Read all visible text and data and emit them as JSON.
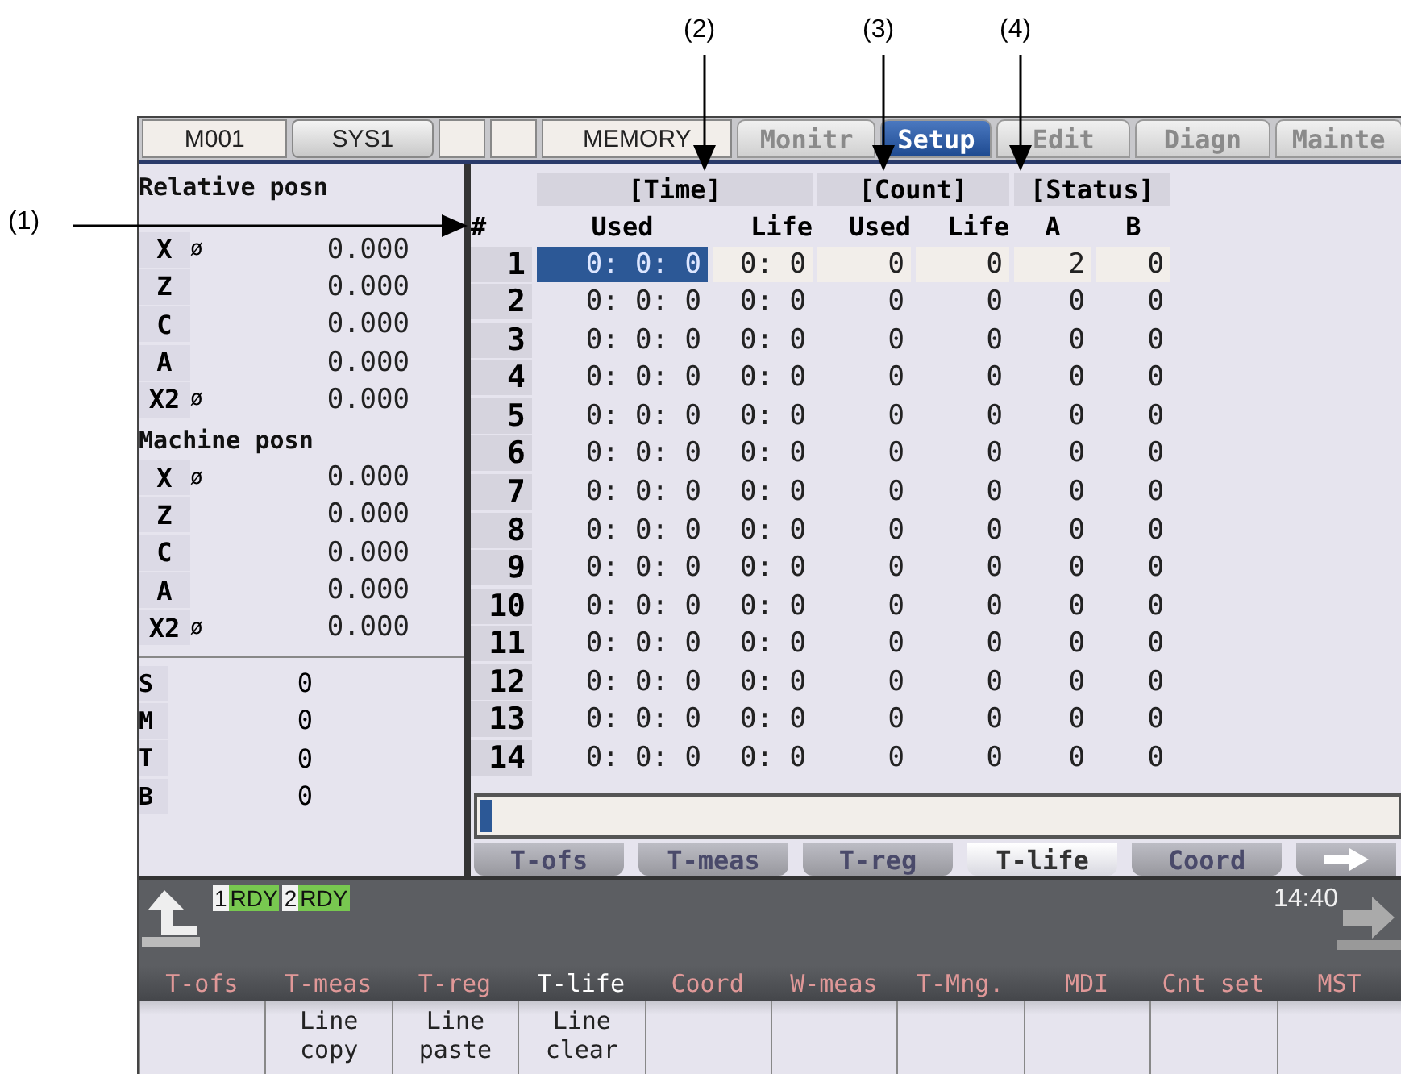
{
  "callouts": [
    {
      "label": "(1)"
    },
    {
      "label": "(2)"
    },
    {
      "label": "(3)"
    },
    {
      "label": "(4)"
    }
  ],
  "top_fields": [
    {
      "kind": "label",
      "text": "M001"
    },
    {
      "kind": "button",
      "text": "SYS1"
    },
    {
      "kind": "blank"
    },
    {
      "kind": "blank"
    },
    {
      "kind": "label",
      "text": "MEMORY"
    }
  ],
  "main_tabs": [
    {
      "label": "Monitr",
      "selected": false
    },
    {
      "label": "Setup",
      "selected": true
    },
    {
      "label": "Edit",
      "selected": false
    },
    {
      "label": "Diagn",
      "selected": false
    },
    {
      "label": "Mainte",
      "selected": false
    }
  ],
  "position_sections": [
    {
      "title": "Relative posn",
      "axes": [
        {
          "name": "X",
          "mark": "ø",
          "value": "0.000"
        },
        {
          "name": "Z",
          "value": "0.000"
        },
        {
          "name": "C",
          "value": "0.000"
        },
        {
          "name": "A",
          "value": "0.000"
        },
        {
          "name": "X2",
          "mark": "ø",
          "value": "0.000"
        }
      ]
    },
    {
      "title": "Machine posn",
      "axes": [
        {
          "name": "X",
          "mark": "ø",
          "value": "0.000"
        },
        {
          "name": "Z",
          "value": "0.000"
        },
        {
          "name": "C",
          "value": "0.000"
        },
        {
          "name": "A",
          "value": "0.000"
        },
        {
          "name": "X2",
          "mark": "ø",
          "value": "0.000"
        }
      ]
    }
  ],
  "commands": [
    {
      "name": "S",
      "value": "0"
    },
    {
      "name": "M",
      "value": "0"
    },
    {
      "name": "T",
      "value": "0"
    },
    {
      "name": "B",
      "value": "0"
    }
  ],
  "table": {
    "groups": [
      "[Time]",
      "[Count]",
      "[Status]"
    ],
    "columns": [
      "#",
      "Used",
      "Life",
      "Used",
      "Life",
      "A",
      "B"
    ],
    "rows": [
      {
        "no": "1",
        "used_time": "0: 0: 0",
        "life_time": "0: 0",
        "used_count": "0",
        "life_count": "0",
        "a": "2",
        "b": "0",
        "selected": true
      },
      {
        "no": "2",
        "used_time": "0: 0: 0",
        "life_time": "0: 0",
        "used_count": "0",
        "life_count": "0",
        "a": "0",
        "b": "0",
        "selected": false
      },
      {
        "no": "3",
        "used_time": "0: 0: 0",
        "life_time": "0: 0",
        "used_count": "0",
        "life_count": "0",
        "a": "0",
        "b": "0",
        "selected": false
      },
      {
        "no": "4",
        "used_time": "0: 0: 0",
        "life_time": "0: 0",
        "used_count": "0",
        "life_count": "0",
        "a": "0",
        "b": "0",
        "selected": false
      },
      {
        "no": "5",
        "used_time": "0: 0: 0",
        "life_time": "0: 0",
        "used_count": "0",
        "life_count": "0",
        "a": "0",
        "b": "0",
        "selected": false
      },
      {
        "no": "6",
        "used_time": "0: 0: 0",
        "life_time": "0: 0",
        "used_count": "0",
        "life_count": "0",
        "a": "0",
        "b": "0",
        "selected": false
      },
      {
        "no": "7",
        "used_time": "0: 0: 0",
        "life_time": "0: 0",
        "used_count": "0",
        "life_count": "0",
        "a": "0",
        "b": "0",
        "selected": false
      },
      {
        "no": "8",
        "used_time": "0: 0: 0",
        "life_time": "0: 0",
        "used_count": "0",
        "life_count": "0",
        "a": "0",
        "b": "0",
        "selected": false
      },
      {
        "no": "9",
        "used_time": "0: 0: 0",
        "life_time": "0: 0",
        "used_count": "0",
        "life_count": "0",
        "a": "0",
        "b": "0",
        "selected": false
      },
      {
        "no": "10",
        "used_time": "0: 0: 0",
        "life_time": "0: 0",
        "used_count": "0",
        "life_count": "0",
        "a": "0",
        "b": "0",
        "selected": false
      },
      {
        "no": "11",
        "used_time": "0: 0: 0",
        "life_time": "0: 0",
        "used_count": "0",
        "life_count": "0",
        "a": "0",
        "b": "0",
        "selected": false
      },
      {
        "no": "12",
        "used_time": "0: 0: 0",
        "life_time": "0: 0",
        "used_count": "0",
        "life_count": "0",
        "a": "0",
        "b": "0",
        "selected": false
      },
      {
        "no": "13",
        "used_time": "0: 0: 0",
        "life_time": "0: 0",
        "used_count": "0",
        "life_count": "0",
        "a": "0",
        "b": "0",
        "selected": false
      },
      {
        "no": "14",
        "used_time": "0: 0: 0",
        "life_time": "0: 0",
        "used_count": "0",
        "life_count": "0",
        "a": "0",
        "b": "0",
        "selected": false
      }
    ]
  },
  "sub_tabs": [
    {
      "label": "T-ofs",
      "selected": false
    },
    {
      "label": "T-meas",
      "selected": false
    },
    {
      "label": "T-reg",
      "selected": false
    },
    {
      "label": "T-life",
      "selected": true
    },
    {
      "label": "Coord",
      "selected": false
    }
  ],
  "part_systems": [
    {
      "number": "1",
      "state": "RDY"
    },
    {
      "number": "2",
      "state": "RDY"
    }
  ],
  "clock": "14:40",
  "menu": [
    {
      "label": "T-ofs",
      "selected": false
    },
    {
      "label": "T-meas",
      "selected": false
    },
    {
      "label": "T-reg",
      "selected": false
    },
    {
      "label": "T-life",
      "selected": true
    },
    {
      "label": "Coord",
      "selected": false
    },
    {
      "label": "W-meas",
      "selected": false
    },
    {
      "label": "T-Mng.",
      "selected": false
    },
    {
      "label": "MDI",
      "selected": false
    },
    {
      "label": "Cnt set",
      "selected": false
    },
    {
      "label": "MST",
      "selected": false
    }
  ],
  "function_keys": [
    {
      "kind": "blank"
    },
    {
      "kind": "text",
      "lines": [
        "Line",
        "copy"
      ]
    },
    {
      "kind": "text",
      "lines": [
        "Line",
        "paste"
      ]
    },
    {
      "kind": "text",
      "lines": [
        "Line",
        "clear"
      ]
    },
    {
      "kind": "blank"
    },
    {
      "kind": "blank"
    },
    {
      "kind": "blank"
    },
    {
      "kind": "blank"
    },
    {
      "kind": "blank"
    },
    {
      "kind": "blank"
    }
  ]
}
